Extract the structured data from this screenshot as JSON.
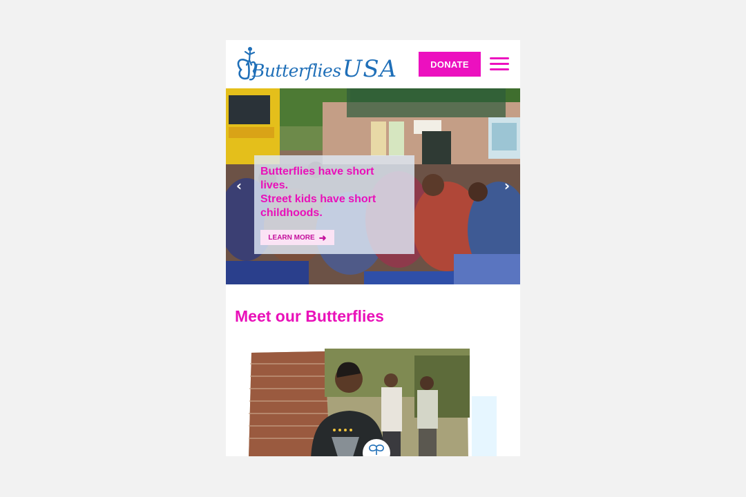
{
  "brand": {
    "logo_word1": "Butterflies",
    "logo_word2": "USA",
    "color": "#1f6fb8"
  },
  "header": {
    "donate_label": "DONATE",
    "menu_icon": "hamburger-icon"
  },
  "hero": {
    "lines": [
      "Butterflies have short",
      "lives.",
      "Street kids have short",
      "childhoods."
    ],
    "cta_label": "LEARN MORE",
    "cta_icon": "arrow-right-icon",
    "prev_icon": "chevron-left-icon",
    "next_icon": "chevron-right-icon"
  },
  "section": {
    "title": "Meet our Butterflies"
  },
  "colors": {
    "accent": "#ec10bf",
    "logo_blue": "#1f6fb8",
    "card_accent": "#e6f6ff"
  }
}
